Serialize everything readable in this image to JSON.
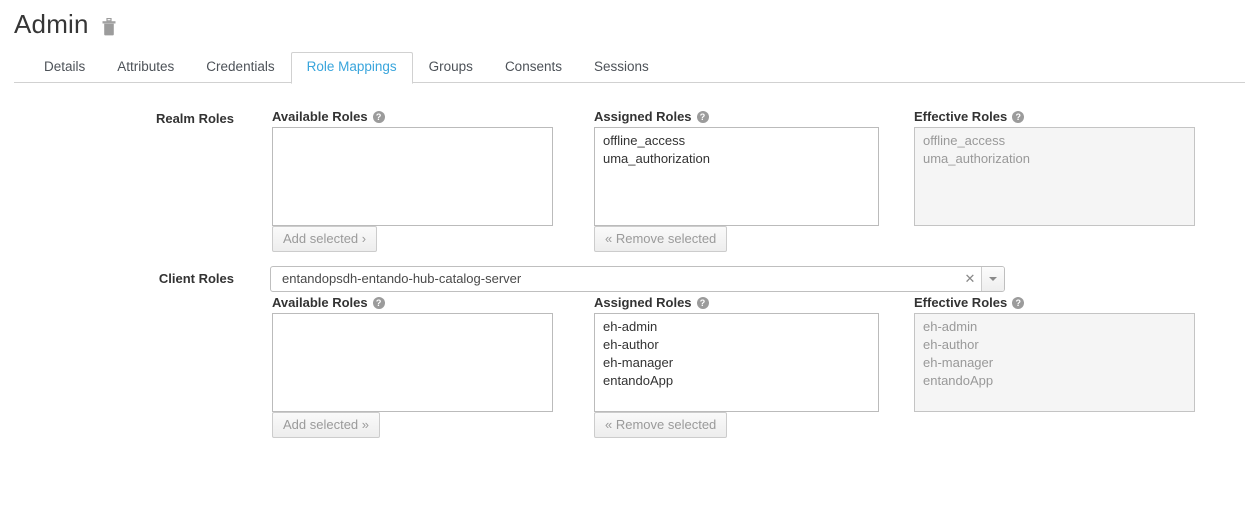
{
  "header": {
    "title": "Admin",
    "delete_icon": "trash-icon"
  },
  "tabs": [
    {
      "label": "Details",
      "active": false
    },
    {
      "label": "Attributes",
      "active": false
    },
    {
      "label": "Credentials",
      "active": false
    },
    {
      "label": "Role Mappings",
      "active": true
    },
    {
      "label": "Groups",
      "active": false
    },
    {
      "label": "Consents",
      "active": false
    },
    {
      "label": "Sessions",
      "active": false
    }
  ],
  "help_glyph": "?",
  "realm_roles": {
    "row_label": "Realm Roles",
    "available": {
      "heading": "Available Roles",
      "items": [],
      "button_label": "Add selected ›"
    },
    "assigned": {
      "heading": "Assigned Roles",
      "items": [
        "offline_access",
        "uma_authorization"
      ],
      "button_label": "« Remove selected"
    },
    "effective": {
      "heading": "Effective Roles",
      "items": [
        "offline_access",
        "uma_authorization"
      ]
    }
  },
  "client_roles": {
    "row_label": "Client Roles",
    "selected_client": "entandopsdh-entando-hub-catalog-server",
    "clear_glyph": "✕",
    "available": {
      "heading": "Available Roles",
      "items": [],
      "button_label": "Add selected »"
    },
    "assigned": {
      "heading": "Assigned Roles",
      "items": [
        "eh-admin",
        "eh-author",
        "eh-manager",
        "entandoApp"
      ],
      "button_label": "« Remove selected"
    },
    "effective": {
      "heading": "Effective Roles",
      "items": [
        "eh-admin",
        "eh-author",
        "eh-manager",
        "entandoApp"
      ]
    }
  },
  "colors": {
    "active_tab": "#39a5dc",
    "text": "#333333",
    "muted": "#999999",
    "border": "#bbbbbb",
    "disabled_bg": "#f5f5f5"
  }
}
